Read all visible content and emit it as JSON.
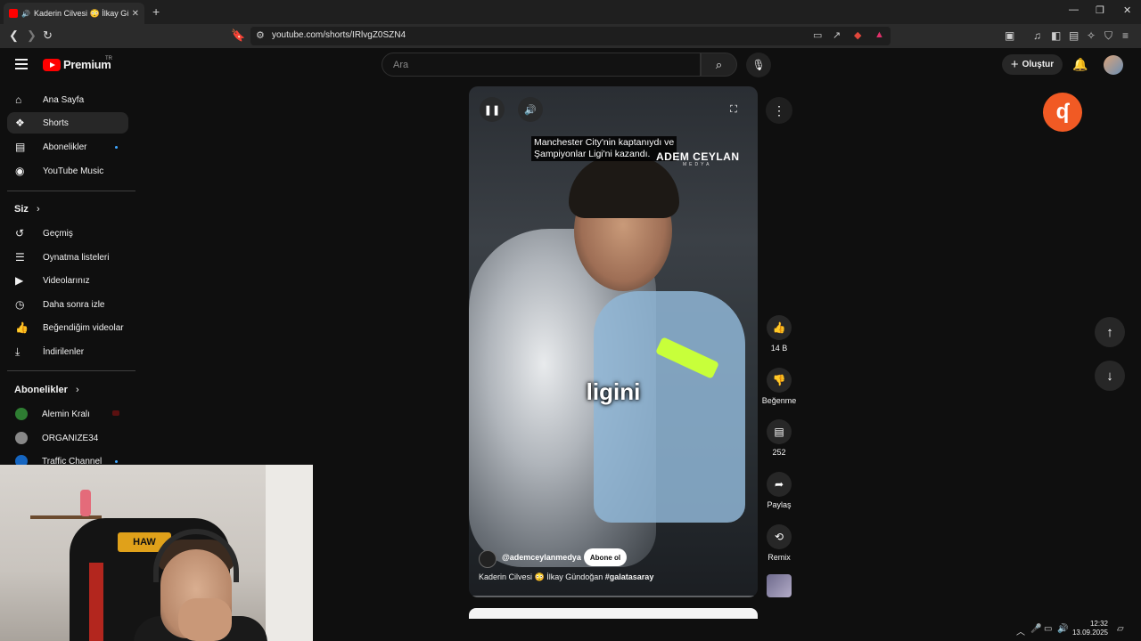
{
  "browser": {
    "tab_title": "Kaderin Cilvesi 😳 İlkay Günd",
    "url": "youtube.com/shorts/IRlvgZ0SZN4"
  },
  "header": {
    "logo_text": "Premium",
    "country": "TR",
    "search_placeholder": "Ara",
    "create_label": "Oluştur"
  },
  "sidebar": {
    "main": [
      {
        "label": "Ana Sayfa",
        "icon": "home-icon"
      },
      {
        "label": "Shorts",
        "icon": "shorts-icon"
      },
      {
        "label": "Abonelikler",
        "icon": "subscriptions-icon"
      },
      {
        "label": "YouTube Music",
        "icon": "youtube-music-icon"
      }
    ],
    "you_heading": "Siz",
    "you": [
      {
        "label": "Geçmiş",
        "icon": "history-icon"
      },
      {
        "label": "Oynatma listeleri",
        "icon": "playlists-icon"
      },
      {
        "label": "Videolarınız",
        "icon": "your-videos-icon"
      },
      {
        "label": "Daha sonra izle",
        "icon": "watch-later-icon"
      },
      {
        "label": "Beğendiğim videolar",
        "icon": "liked-videos-icon"
      },
      {
        "label": "İndirilenler",
        "icon": "downloads-icon"
      }
    ],
    "subs_heading": "Abonelikler",
    "subs": [
      {
        "label": "Alemin Kralı",
        "color": "#2e7d32"
      },
      {
        "label": "ORGANIZE34",
        "color": "#888888"
      },
      {
        "label": "Traffic Channel",
        "color": "#1565c0"
      }
    ]
  },
  "player": {
    "caption": "Manchester City'nin kaptanıydı ve Şampiyonlar Ligi'ni kazandı.",
    "caption_line1": "Manchester City'nin kaptanıydı ve",
    "caption_line2": "Şampiyonlar Ligi'ni kazandı.",
    "brand": "ADEM CEYLAN",
    "brand_sub": "MEDYA",
    "subtitle": "ligini",
    "channel": "@ademceylanmedya",
    "subscribe_label": "Abone ol",
    "title_text": "Kaderin Cilvesi 😳 İlkay Gündoğan ",
    "title_tag": "#galatasaray"
  },
  "actions": {
    "likes": "14 B",
    "dislike": "Beğenme",
    "comments": "252",
    "share": "Paylaş",
    "remix": "Remix"
  },
  "webcam": {
    "chair_brand": "HAW"
  },
  "taskbar": {
    "time": "12:32",
    "date": "13.09.2025"
  },
  "colors": {
    "youtube_red": "#ff0000",
    "background": "#0f0f0f",
    "brand_badge": "#f15a24"
  }
}
